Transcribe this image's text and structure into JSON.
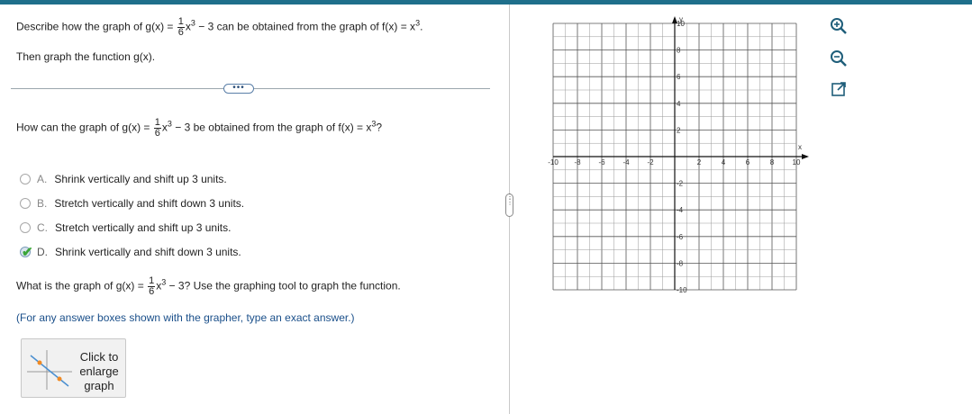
{
  "question": {
    "intro_prefix": "Describe how the graph of g(x) =",
    "frac_num": "1",
    "frac_den": "6",
    "x_var": "x",
    "exp3": "3",
    "intro_middle": " − 3 can be obtained from the graph of f(x) = x",
    "intro_end": ".",
    "intro_line2": "Then graph the function g(x).",
    "more_label": "•••",
    "part1_prefix": "How can the graph of g(x) =",
    "part1_middle": " − 3 be obtained from the graph of f(x) = x",
    "part1_end": "?",
    "choices": [
      {
        "letter": "A.",
        "text": "Shrink vertically and shift up 3 units.",
        "selected": false
      },
      {
        "letter": "B.",
        "text": "Stretch vertically and shift down 3 units.",
        "selected": false
      },
      {
        "letter": "C.",
        "text": "Stretch vertically and shift up 3 units.",
        "selected": false
      },
      {
        "letter": "D.",
        "text": "Shrink vertically and shift down 3 units.",
        "selected": true
      }
    ],
    "part2_prefix": "What is the graph of g(x) =",
    "part2_middle": " − 3?  Use the graphing tool to graph the function.",
    "hint": "(For any answer boxes shown with the grapher, type an exact answer.)",
    "enlarge_line1": "Click to",
    "enlarge_line2": "enlarge",
    "enlarge_line3": "graph"
  },
  "graph": {
    "x_label": "x",
    "y_label": "y",
    "x_ticks": [
      "-10",
      "-8",
      "-6",
      "-4",
      "-2",
      "2",
      "4",
      "6",
      "8",
      "10"
    ],
    "y_ticks": [
      "10",
      "8",
      "6",
      "4",
      "2",
      "-2",
      "-4",
      "-6",
      "-8",
      "-10"
    ],
    "xlim": [
      -10,
      10
    ],
    "ylim": [
      -10,
      10
    ],
    "grid": true
  },
  "tools": [
    {
      "icon": "zoom-in-icon"
    },
    {
      "icon": "zoom-out-icon"
    },
    {
      "icon": "popout-icon"
    }
  ],
  "colors": {
    "topbar": "#1f6f8b",
    "hint_text": "#1a4f8a",
    "check": "#3aa537"
  }
}
